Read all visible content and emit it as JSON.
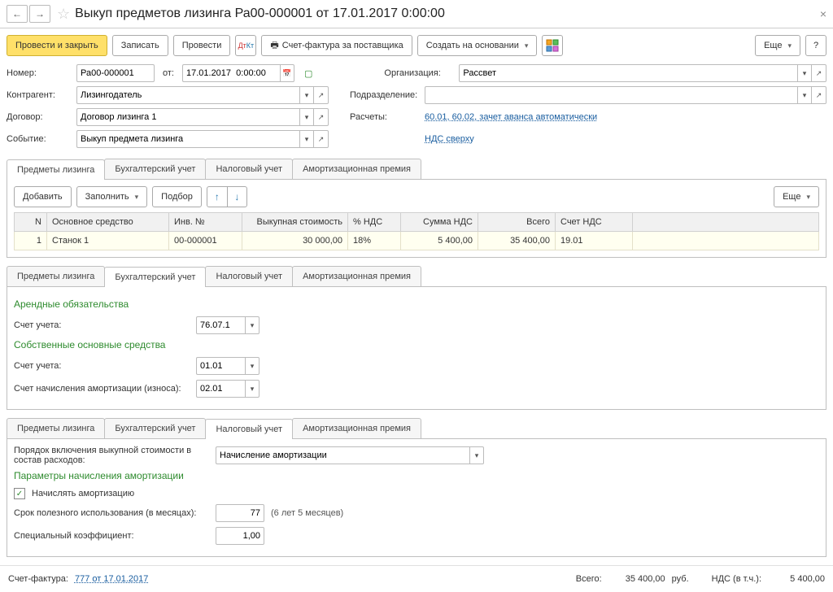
{
  "header": {
    "title": "Выкуп предметов лизинга Ра00-000001 от 17.01.2017 0:00:00"
  },
  "toolbar": {
    "post_close": "Провести и закрыть",
    "write": "Записать",
    "post": "Провести",
    "invoice": "Счет-фактура за поставщика",
    "create_based": "Создать на основании",
    "more": "Еще"
  },
  "fields": {
    "number_lbl": "Номер:",
    "number": "Ра00-000001",
    "from_lbl": "от:",
    "date": "17.01.2017  0:00:00",
    "org_lbl": "Организация:",
    "org": "Рассвет",
    "contragent_lbl": "Контрагент:",
    "contragent": "Лизингодатель",
    "division_lbl": "Подразделение:",
    "division": "",
    "contract_lbl": "Договор:",
    "contract": "Договор лизинга 1",
    "calc_lbl": "Расчеты:",
    "calc_link": "60.01, 60.02, зачет аванса автоматически",
    "event_lbl": "Событие:",
    "event": "Выкуп предмета лизинга",
    "vat_link": "НДС сверху"
  },
  "tabs": {
    "t1": "Предметы лизинга",
    "t2": "Бухгалтерский учет",
    "t3": "Налоговый учет",
    "t4": "Амортизационная премия"
  },
  "tab1": {
    "add": "Добавить",
    "fill": "Заполнить",
    "select": "Подбор",
    "more": "Еще",
    "cols": {
      "n": "N",
      "asset": "Основное средство",
      "inv": "Инв. №",
      "cost": "Выкупная стоимость",
      "vatp": "% НДС",
      "vatsum": "Сумма НДС",
      "total": "Всего",
      "vatacc": "Счет НДС"
    },
    "rows": [
      {
        "n": "1",
        "asset": "Станок 1",
        "inv": "00-000001",
        "cost": "30 000,00",
        "vatp": "18%",
        "vatsum": "5 400,00",
        "total": "35 400,00",
        "vatacc": "19.01"
      }
    ]
  },
  "tab2": {
    "sec1": "Арендные обязательства",
    "acc_lbl": "Счет учета:",
    "acc1": "76.07.1",
    "sec2": "Собственные основные средства",
    "acc2": "01.01",
    "dep_lbl": "Счет начисления амортизации (износа):",
    "dep": "02.01"
  },
  "tab3": {
    "order_lbl": "Порядок включения выкупной стоимости в состав расходов:",
    "order_val": "Начисление амортизации",
    "params": "Параметры начисления амортизации",
    "calc_dep": "Начислять амортизацию",
    "life_lbl": "Срок полезного использования (в месяцах):",
    "life_val": "77",
    "life_hint": "(6 лет 5 месяцев)",
    "coef_lbl": "Специальный коэффициент:",
    "coef_val": "1,00"
  },
  "footer": {
    "invoice_lbl": "Счет-фактура:",
    "invoice_link": "777 от 17.01.2017",
    "total_lbl": "Всего:",
    "total": "35 400,00",
    "cur": "руб.",
    "vat_lbl": "НДС (в т.ч.):",
    "vat": "5 400,00"
  }
}
